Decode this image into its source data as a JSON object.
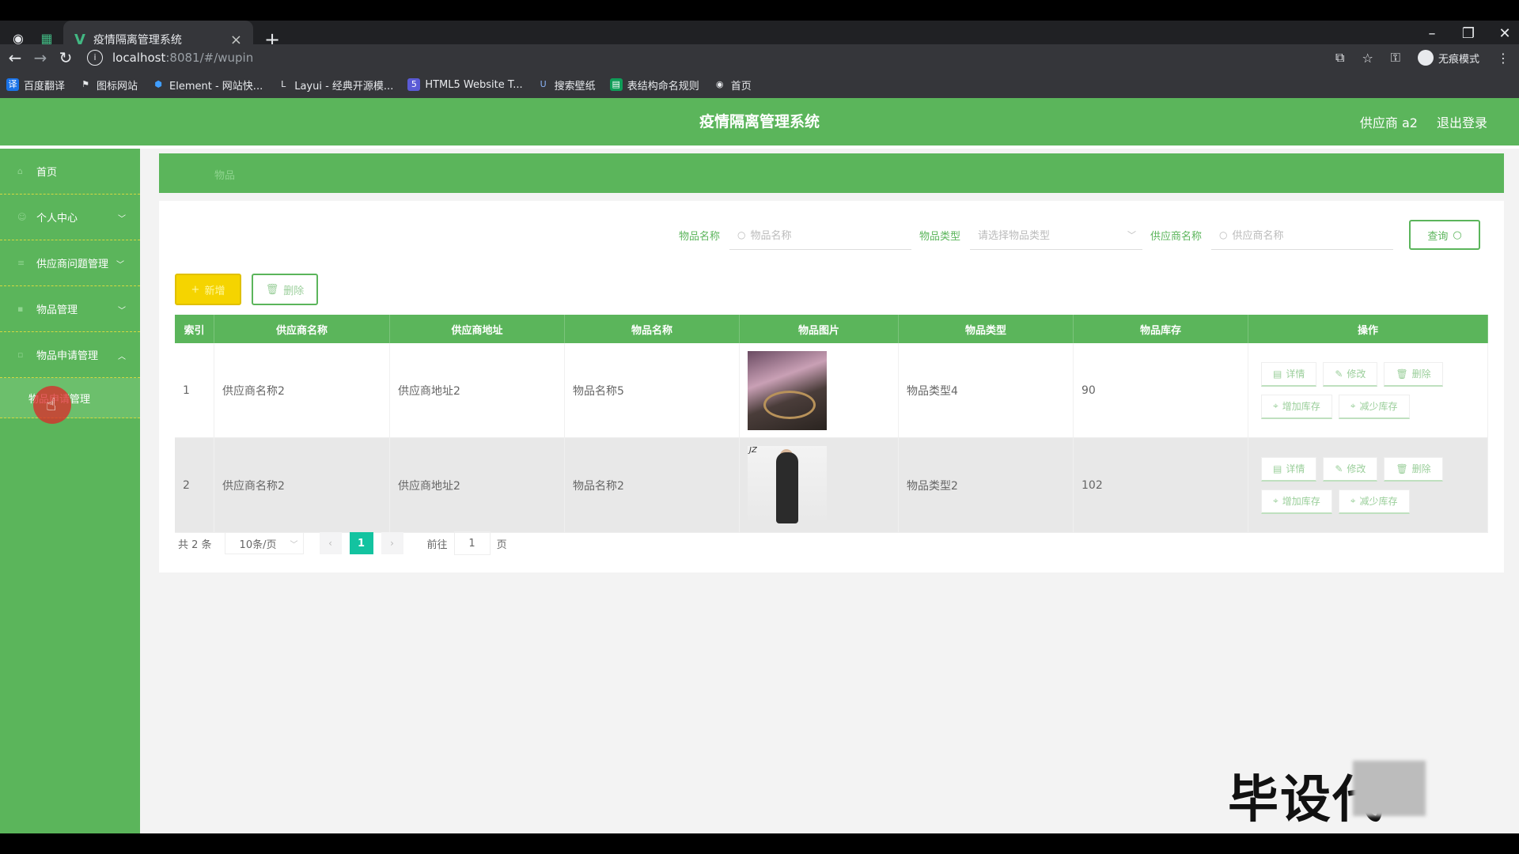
{
  "browser": {
    "tab_title": "疫情隔离管理系统",
    "url_host": "localhost",
    "url_path": ":8081/#/wupin",
    "profile": "无痕模式",
    "bookmarks": [
      "百度翻译",
      "图标网站",
      "Element - 网站快...",
      "Layui - 经典开源模...",
      "HTML5 Website T...",
      "搜索壁纸",
      "表结构命名规则",
      "首页"
    ]
  },
  "header": {
    "title": "疫情隔离管理系统",
    "user": "供应商 a2",
    "logout": "退出登录"
  },
  "sidebar": {
    "items": [
      {
        "label": "首页"
      },
      {
        "label": "个人中心"
      },
      {
        "label": "供应商问题管理"
      },
      {
        "label": "物品管理"
      },
      {
        "label": "物品申请管理"
      }
    ],
    "sub_active": "物品申请管理"
  },
  "breadcrumb": "物品",
  "search": {
    "name_label": "物品名称",
    "name_placeholder": "物品名称",
    "type_label": "物品类型",
    "type_placeholder": "请选择物品类型",
    "supplier_label": "供应商名称",
    "supplier_placeholder": "供应商名称",
    "query_button": "查询"
  },
  "actions": {
    "add": "新增",
    "delete": "删除"
  },
  "table": {
    "headers": [
      "索引",
      "供应商名称",
      "供应商地址",
      "物品名称",
      "物品图片",
      "物品类型",
      "物品库存",
      "操作"
    ],
    "rows": [
      {
        "index": "1",
        "supplier": "供应商名称2",
        "address": "供应商地址2",
        "name": "物品名称5",
        "type": "物品类型4",
        "stock": "90"
      },
      {
        "index": "2",
        "supplier": "供应商名称2",
        "address": "供应商地址2",
        "name": "物品名称2",
        "type": "物品类型2",
        "stock": "102"
      }
    ],
    "ops": {
      "detail": "详情",
      "edit": "修改",
      "delete": "删除",
      "add_stock": "增加库存",
      "reduce_stock": "减少库存"
    },
    "thumb2_tag": "JZ"
  },
  "pager": {
    "total": "共 2 条",
    "page_size": "10条/页",
    "current": "1",
    "goto_label": "前往",
    "goto_value": "1",
    "page_unit": "页"
  },
  "watermark": "毕设代"
}
